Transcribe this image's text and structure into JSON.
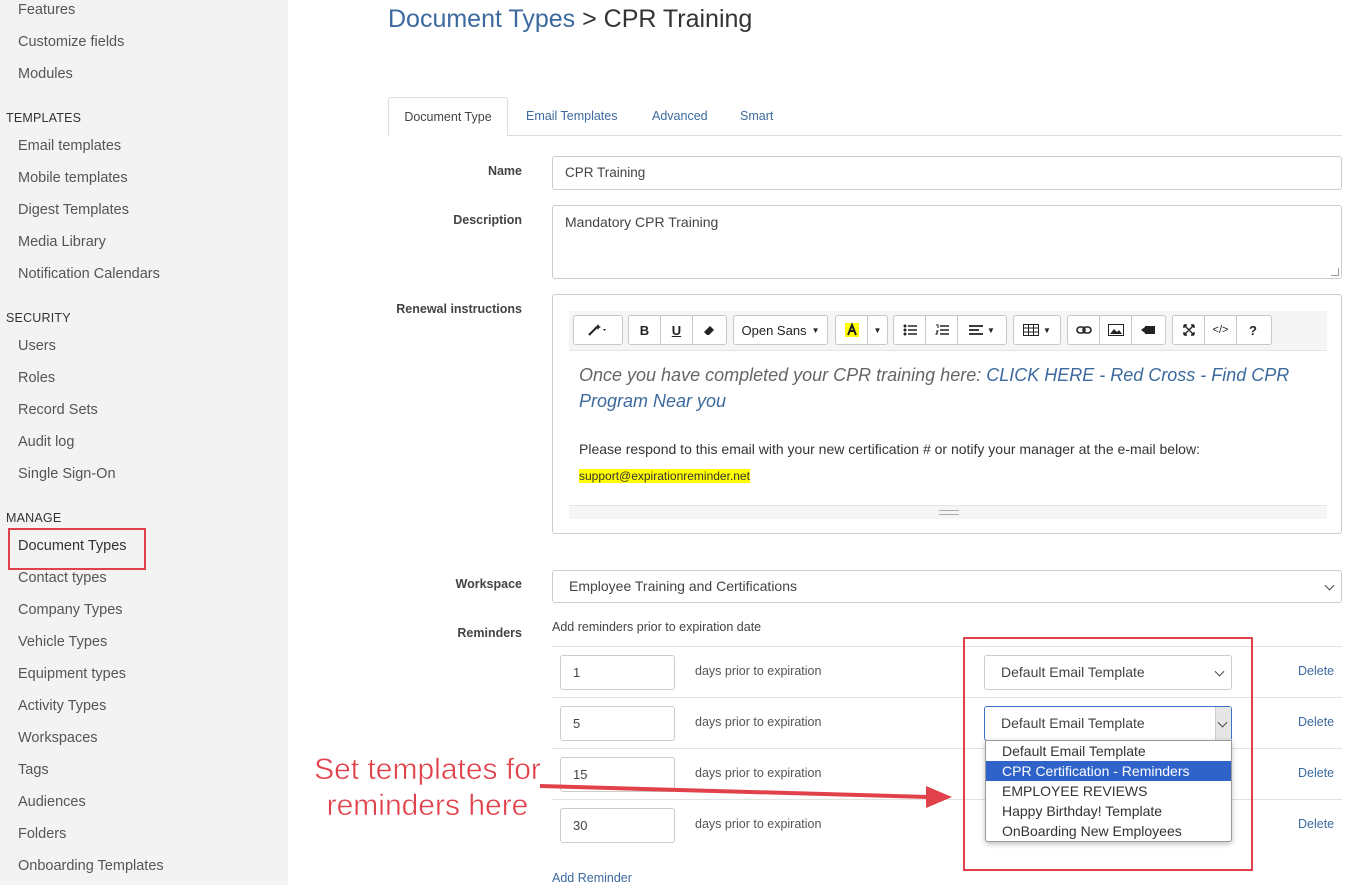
{
  "sidebar": {
    "top_items": [
      "Features",
      "Customize fields",
      "Modules"
    ],
    "templates": {
      "heading": "TEMPLATES",
      "items": [
        "Email templates",
        "Mobile templates",
        "Digest Templates",
        "Media Library",
        "Notification Calendars"
      ]
    },
    "security": {
      "heading": "SECURITY",
      "items": [
        "Users",
        "Roles",
        "Record Sets",
        "Audit log",
        "Single Sign-On"
      ]
    },
    "manage": {
      "heading": "MANAGE",
      "items": [
        "Document Types",
        "Contact types",
        "Company Types",
        "Vehicle Types",
        "Equipment types",
        "Activity Types",
        "Workspaces",
        "Tags",
        "Audiences",
        "Folders",
        "Onboarding Templates"
      ]
    }
  },
  "header": {
    "crumb": "Document Types",
    "separator": ">",
    "current": "CPR Training"
  },
  "tabs": [
    "Document Type",
    "Email Templates",
    "Advanced",
    "Smart"
  ],
  "form": {
    "name_label": "Name",
    "name_value": "CPR Training",
    "description_label": "Description",
    "description_value": "Mandatory CPR Training",
    "renewal_label": "Renewal instructions",
    "workspace_label": "Workspace",
    "workspace_value": "Employee Training and Certifications",
    "reminders_label": "Reminders",
    "reminders_help": "Add reminders prior to expiration date",
    "add_reminder": "Add Reminder"
  },
  "editor": {
    "font": "Open Sans",
    "intro_plain": "Once you have completed your CPR training here: ",
    "intro_link": "CLICK HERE - Red Cross - Find CPR Program Near you",
    "respond": "Please respond to this email with your new certification # or notify your manager at the e-mail below:",
    "support_email": "support@expirationreminder.net",
    "toolbar_glyphs": {
      "bold": "B",
      "underline": "U",
      "help": "?",
      "code": "</>"
    }
  },
  "reminders": [
    {
      "days": "1",
      "suffix": "days prior to expiration",
      "template": "Default Email Template",
      "delete": "Delete"
    },
    {
      "days": "5",
      "suffix": "days prior to expiration",
      "template": "Default Email Template",
      "delete": "Delete"
    },
    {
      "days": "15",
      "suffix": "days prior to expiration",
      "delete": "Delete"
    },
    {
      "days": "30",
      "suffix": "days prior to expiration",
      "delete": "Delete"
    }
  ],
  "dropdown_options": [
    "Default Email Template",
    "CPR Certification - Reminders",
    "EMPLOYEE REVIEWS",
    "Happy Birthday! Template",
    "OnBoarding New Employees"
  ],
  "annotation": {
    "text": "Set templates for reminders here",
    "color": "#e0414a"
  },
  "colors": {
    "accent": "#3c6a9e",
    "selected": "#2f63c9",
    "highlight": "#ffff00",
    "annotation": "#e0414a"
  }
}
